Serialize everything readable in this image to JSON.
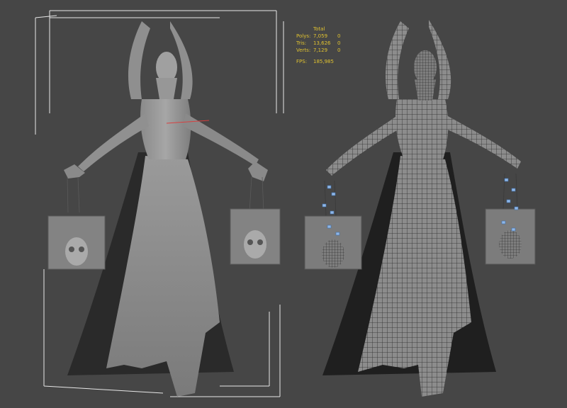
{
  "viewport": {
    "background": "#464646"
  },
  "stats": {
    "header": "Total",
    "rows": [
      {
        "label": "Polys:",
        "total": "7,059",
        "selected": "0"
      },
      {
        "label": "Tris:",
        "total": "13,626",
        "selected": "0"
      },
      {
        "label": "Verts:",
        "total": "7,129",
        "selected": "0"
      }
    ],
    "fps_label": "FPS:",
    "fps_value": "185,985",
    "color": "#e0c230"
  }
}
